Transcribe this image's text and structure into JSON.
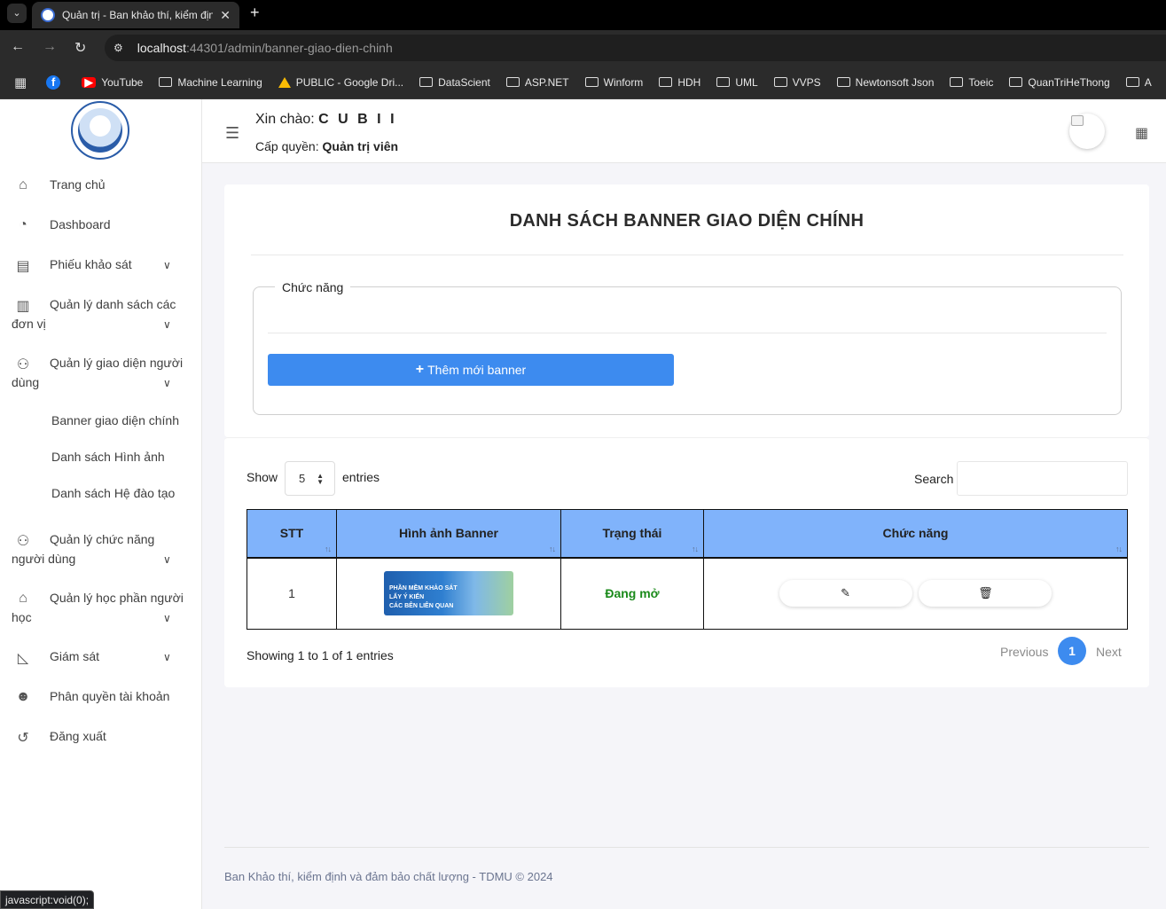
{
  "browser": {
    "tab_title": "Quản trị - Ban khảo thí, kiểm định và đảm bảo chất lượng",
    "tab_close": "✕",
    "new_tab": "+",
    "url_host": "localhost",
    "url_rest": ":44301/admin/banner-giao-dien-chinh",
    "bookmarks": [
      "YouTube",
      "Machine Learning",
      "PUBLIC - Google Dri...",
      "DataScient",
      "ASP.NET",
      "Winform",
      "HDH",
      "UML",
      "VVPS",
      "Newtonsoft Json",
      "Toeic",
      "QuanTriHeThong",
      "A"
    ]
  },
  "header": {
    "greeting_prefix": "Xin chào:",
    "user_name": "C U B I I",
    "role_prefix": "Cấp quyền:",
    "role_value": "Quản trị viên"
  },
  "sidebar": {
    "items": [
      {
        "label": "Trang chủ"
      },
      {
        "label": "Dashboard"
      },
      {
        "label": "Phiếu khảo sát"
      },
      {
        "label": "Quản lý danh sách các",
        "label2": "đơn vị"
      },
      {
        "label": "Quản lý giao diện người",
        "label2": "dùng"
      },
      {
        "label": "Quản lý chức năng",
        "label2": "người dùng"
      },
      {
        "label": "Quản lý học phần người",
        "label2": "học"
      },
      {
        "label": "Giám sát"
      },
      {
        "label": "Phân quyền tài khoản"
      },
      {
        "label": "Đăng xuất"
      }
    ],
    "submenu": [
      "Banner giao diện chính",
      "Danh sách Hình ảnh",
      "Danh sách Hệ đào tạo"
    ]
  },
  "page": {
    "title": "DANH SÁCH BANNER GIAO DIỆN CHÍNH",
    "fieldset_legend": "Chức năng",
    "add_button": "Thêm mới banner"
  },
  "table_controls": {
    "show_label": "Show",
    "page_size": "5",
    "entries_label": "entries",
    "search_label": "Search"
  },
  "table": {
    "columns": [
      "STT",
      "Hình ảnh Banner",
      "Trạng thái",
      "Chức năng"
    ],
    "rows": [
      {
        "stt": "1",
        "banner_lines": [
          "PHẦN MỀM KHẢO SÁT",
          "LẤY Ý KIẾN",
          "CÁC BÊN LIÊN QUAN"
        ],
        "status": "Đang mở"
      }
    ]
  },
  "pagination": {
    "info": "Showing 1 to 1 of 1 entries",
    "previous": "Previous",
    "current": "1",
    "next": "Next"
  },
  "footer": {
    "text": "Ban Khảo thí, kiểm định và đảm bảo chất lượng - TDMU © 2024"
  },
  "status_bar": "javascript:void(0);",
  "colors": {
    "accent": "#3d8bef",
    "table_header": "#80b3fb",
    "status_open": "#1a8a1a"
  }
}
